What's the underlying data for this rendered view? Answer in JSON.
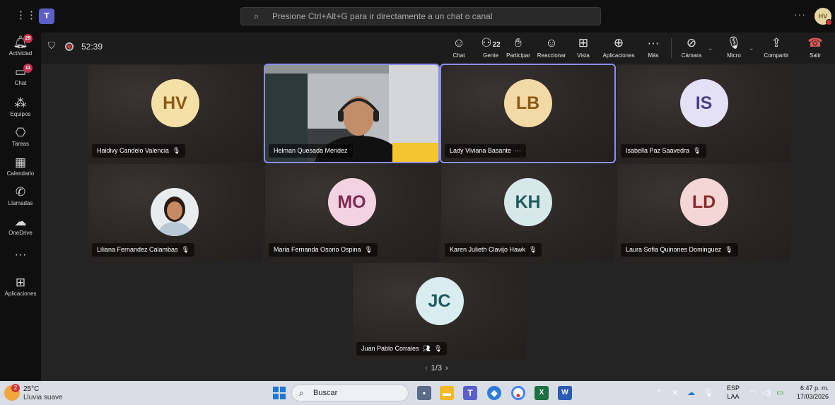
{
  "topbar": {
    "search_placeholder": "Presione Ctrl+Alt+G para ir directamente a un chat o canal",
    "more": "···",
    "avatar_initials": "HV"
  },
  "rail": [
    {
      "label": "Actividad",
      "badge": "29"
    },
    {
      "label": "Chat",
      "badge": "11"
    },
    {
      "label": "Equipos",
      "badge": ""
    },
    {
      "label": "Tareas",
      "badge": ""
    },
    {
      "label": "Calendario",
      "badge": ""
    },
    {
      "label": "Llamadas",
      "badge": ""
    },
    {
      "label": "OneDrive",
      "badge": ""
    },
    {
      "label": "",
      "badge": ""
    },
    {
      "label": "Aplicaciones",
      "badge": ""
    }
  ],
  "callbar": {
    "timer": "52:39",
    "people_count": "22",
    "buttons": {
      "chat": "Chat",
      "people": "Gente",
      "raise": "Participar",
      "react": "Reaccionar",
      "view": "Vista",
      "apps": "Aplicaciones",
      "more": "Más",
      "camera": "Cámara",
      "mic": "Micro",
      "share": "Compartir",
      "leave": "Salir"
    }
  },
  "tiles": [
    {
      "name": "Haidivy Candelo Valencia",
      "initials": "HV",
      "bg": "#f5e0a8",
      "fg": "#8b5a12",
      "muted": true
    },
    {
      "name": "Helman Quesada Mendez",
      "initials": "",
      "bg": "",
      "fg": "",
      "muted": false,
      "video": true
    },
    {
      "name": "Lady Viviana Basante",
      "initials": "LB",
      "bg": "#f2d9a6",
      "fg": "#8b5a12",
      "muted": false,
      "more": "···"
    },
    {
      "name": "Isabella Paz Saavedra",
      "initials": "IS",
      "bg": "#e4e0f5",
      "fg": "#4b3f8c",
      "muted": true
    },
    {
      "name": "Liliana Fernandez Calambas",
      "initials": "",
      "bg": "",
      "fg": "",
      "muted": true,
      "photo": true
    },
    {
      "name": "Maria Fernanda Osorio Ospina",
      "initials": "MO",
      "bg": "#f3d3e1",
      "fg": "#7d2a52",
      "muted": true
    },
    {
      "name": "Karen Julieth Clavijo Hawk",
      "initials": "KH",
      "bg": "#d7e8ea",
      "fg": "#1f5a60",
      "muted": true
    },
    {
      "name": "Laura Sofia Quinones Dominguez",
      "initials": "LD",
      "bg": "#f5d6d6",
      "fg": "#8a2a2a",
      "muted": true
    },
    {
      "name": "Juan Pablo Corrales",
      "initials": "JC",
      "bg": "#d9ecef",
      "fg": "#1f5a60",
      "muted": true,
      "extra_icon": true
    }
  ],
  "pager": {
    "label": "1/3"
  },
  "taskbar": {
    "temp": "25°C",
    "weather": "Lluvia suave",
    "weather_badge": "2",
    "search": "Buscar",
    "lang_top": "ESP",
    "lang_bottom": "LAA",
    "time": "6:47 p. m.",
    "date": "17/03/2026"
  }
}
